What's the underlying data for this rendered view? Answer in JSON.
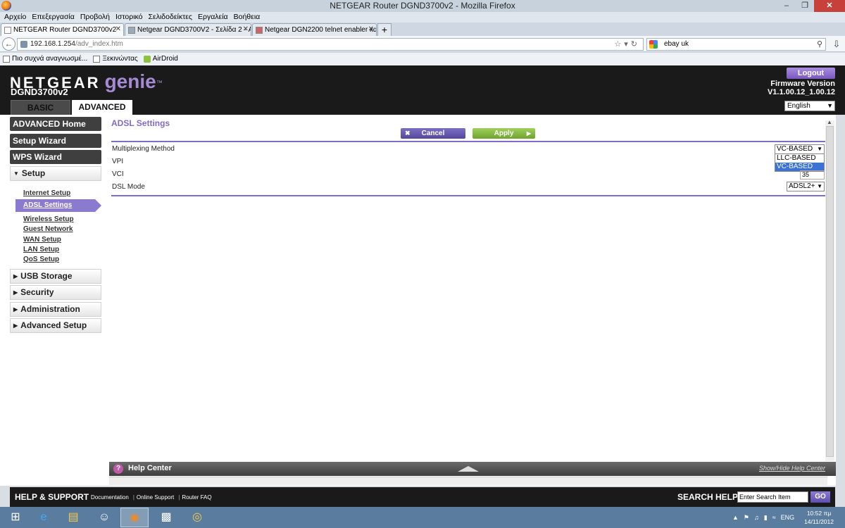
{
  "window": {
    "title": "NETGEAR Router DGND3700v2 - Mozilla Firefox"
  },
  "menu": [
    "Αρχείο",
    "Επεξεργασία",
    "Προβολή",
    "Ιστορικό",
    "Σελιδοδείκτες",
    "Εργαλεία",
    "Βοήθεια"
  ],
  "tabs": [
    {
      "label": "NETGEAR Router DGND3700v2"
    },
    {
      "label": "Netgear DGND3700V2 - Σελίδα 2 - AD..."
    },
    {
      "label": "Netgear DGN2200 telnet enabler και s..."
    }
  ],
  "url": {
    "host": "192.168.1.254",
    "path": "/adv_index.htm"
  },
  "search": {
    "value": "ebay uk"
  },
  "bookmarks": [
    "Πιο συχνά αναγνωσμέ...",
    "Ξεκινώντας",
    "AirDroid"
  ],
  "netgear": {
    "brand": "NETGEAR",
    "genie": "genie",
    "tm": "™",
    "model": "DGND3700v2",
    "tab_basic": "BASIC",
    "tab_advanced": "ADVANCED",
    "logout": "Logout",
    "fw_label": "Firmware Version",
    "fw_value": "V1.1.00.12_1.00.12",
    "language": "English"
  },
  "sidebar": {
    "buttons": [
      "ADVANCED Home",
      "Setup Wizard",
      "WPS Wizard"
    ],
    "setup": "Setup",
    "setup_links": [
      "Internet Setup",
      "ADSL Settings",
      "Wireless Setup",
      "Guest Network",
      "WAN Setup",
      "LAN Setup",
      "QoS Setup"
    ],
    "sections": [
      "USB Storage",
      "Security",
      "Administration",
      "Advanced Setup"
    ]
  },
  "content": {
    "title": "ADSL Settings",
    "cancel": "Cancel",
    "apply": "Apply",
    "mux_label": "Multiplexing Method",
    "mux_value": "VC-BASED",
    "mux_options": [
      "LLC-BASED",
      "VC-BASED"
    ],
    "vpi_label": "VPI",
    "vci_label": "VCI",
    "vci_value": "35",
    "dsl_label": "DSL Mode",
    "dsl_value": "ADSL2+"
  },
  "help_bar": {
    "title": "Help Center",
    "toggle": "Show/Hide Help Center"
  },
  "support": {
    "title": "HELP & SUPPORT",
    "links": [
      "Documentation",
      "Online Support",
      "Router FAQ"
    ],
    "search_label": "SEARCH HELP",
    "search_placeholder": "Enter Search Item",
    "go": "GO"
  },
  "taskbar": {
    "lang": "ENG",
    "time": "10:52 πμ",
    "date": "14/11/2012"
  },
  "colors": {
    "accent": "#7e6cc6",
    "apply": "#7cb342",
    "header": "#1a1a1a"
  }
}
